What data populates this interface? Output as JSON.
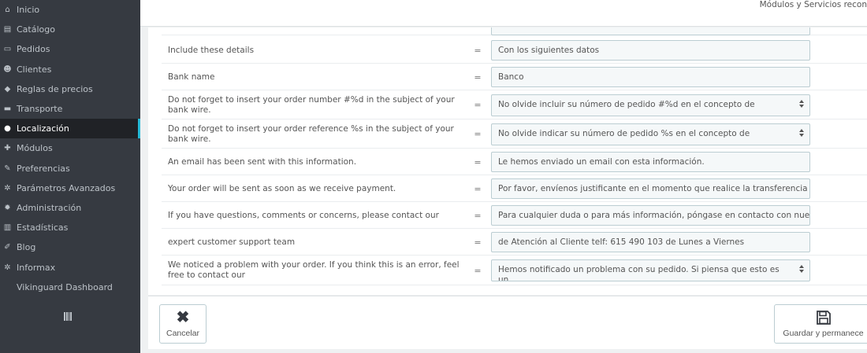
{
  "sidebar": {
    "items": [
      {
        "label": "Inicio",
        "icon": "store-icon",
        "glyph": "⌂"
      },
      {
        "label": "Catálogo",
        "icon": "book-icon",
        "glyph": "▤"
      },
      {
        "label": "Pedidos",
        "icon": "credit-card-icon",
        "glyph": "▭"
      },
      {
        "label": "Clientes",
        "icon": "users-icon",
        "glyph": "☻"
      },
      {
        "label": "Reglas de precios",
        "icon": "tag-icon",
        "glyph": "◆"
      },
      {
        "label": "Transporte",
        "icon": "truck-icon",
        "glyph": "▬"
      },
      {
        "label": "Localización",
        "icon": "globe-icon",
        "glyph": "●"
      },
      {
        "label": "Módulos",
        "icon": "puzzle-icon",
        "glyph": "✚"
      },
      {
        "label": "Preferencias",
        "icon": "wrench-icon",
        "glyph": "✎"
      },
      {
        "label": "Parámetros Avanzados",
        "icon": "cogs-icon",
        "glyph": "✲"
      },
      {
        "label": "Administración",
        "icon": "cog-icon",
        "glyph": "✹"
      },
      {
        "label": "Estadísticas",
        "icon": "bar-chart-icon",
        "glyph": "▥"
      },
      {
        "label": "Blog",
        "icon": "edit-icon",
        "glyph": "✐"
      },
      {
        "label": "Informax",
        "icon": "cogs-icon",
        "glyph": "✲"
      },
      {
        "label": "Vikinguard Dashboard",
        "icon": "",
        "glyph": ""
      }
    ],
    "active_index": 6
  },
  "header": {
    "breadcrumb": "Módulos y Servicios recon"
  },
  "rows": [
    {
      "label": "",
      "value": "",
      "type": "input"
    },
    {
      "label": "Include these details",
      "value": "Con los siguientes datos",
      "type": "input"
    },
    {
      "label": "Bank name",
      "value": "Banco",
      "type": "input"
    },
    {
      "label": "Do not forget to insert your order number #%d in the subject of your bank wire.",
      "value": "No olvide incluir su número de pedido #%d en el concepto de",
      "type": "textarea"
    },
    {
      "label": "Do not forget to insert your order reference %s in the subject of your bank wire.",
      "value": "No olvide indicar su número de pedido %s en el concepto de",
      "type": "textarea"
    },
    {
      "label": "An email has been sent with this information.",
      "value": "Le hemos enviado un email con esta información.",
      "type": "input"
    },
    {
      "label": "Your order will be sent as soon as we receive payment.",
      "value": "Por favor, envíenos justificante en el momento que realice la transferencia ba",
      "type": "input"
    },
    {
      "label": "If you have questions, comments or concerns, please contact our",
      "value": "Para cualquier duda o para más información, póngase en contacto con nuestı",
      "type": "input"
    },
    {
      "label": "expert customer support team",
      "value": "de Atención al Cliente telf: 615 490 103 de Lunes a Viernes",
      "type": "input"
    },
    {
      "label": "We noticed a problem with your order. If you think this is an error, feel free to contact our",
      "value": "Hemos notificado un problema con su pedido. Si piensa que esto es un",
      "type": "textarea"
    }
  ],
  "equals_sign": "=",
  "footer": {
    "cancel_label": "Cancelar",
    "save_label": "Guardar y permanece"
  },
  "colors": {
    "sidebar_bg": "#363a41",
    "active_accent": "#25b9d7",
    "field_bg": "#f5f8f9",
    "field_border": "#bbcdd2"
  }
}
